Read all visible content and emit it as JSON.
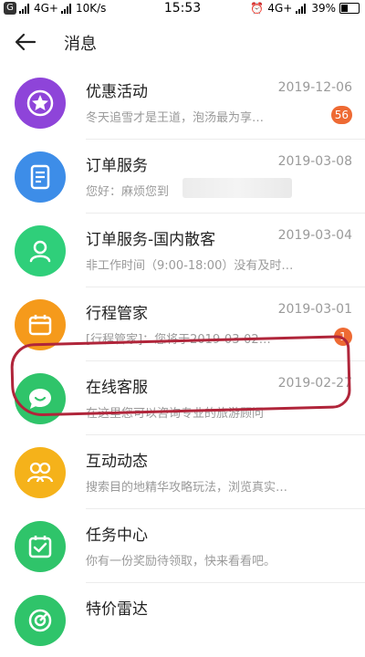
{
  "status_bar": {
    "carrier_icon": "G",
    "network_left": "4G+",
    "speed": "10K/s",
    "time": "15:53",
    "network_right": "4G+",
    "battery": "39%"
  },
  "header": {
    "title": "消息"
  },
  "messages": [
    {
      "name": "优惠活动",
      "date": "2019-12-06",
      "preview": "冬天追雪才是王道，泡汤最为享…",
      "badge": "56",
      "icon": "star-icon",
      "color": "#8e44d9"
    },
    {
      "name": "订单服务",
      "date": "2019-03-08",
      "preview": "您好：麻烦您到",
      "badge": "",
      "icon": "document-icon",
      "color": "#3d8de8"
    },
    {
      "name": "订单服务-国内散客",
      "date": "2019-03-04",
      "preview": "非工作时间（9:00-18:00）没有及时…",
      "badge": "",
      "icon": "person-icon",
      "color": "#2fcf7a"
    },
    {
      "name": "行程管家",
      "date": "2019-03-01",
      "preview": "[行程管家]：您将于2019-03-02…",
      "badge": "1",
      "icon": "calendar-icon",
      "color": "#f59a1b"
    },
    {
      "name": "在线客服",
      "date": "2019-02-27",
      "preview": "在这里您可以咨询专业的旅游顾问",
      "badge": "",
      "icon": "chat-bubble-icon",
      "color": "#2fc46a"
    },
    {
      "name": "互动动态",
      "date": "",
      "preview": "搜索目的地精华攻略玩法，浏览真实…",
      "badge": "",
      "icon": "people-icon",
      "color": "#f5b21a"
    },
    {
      "name": "任务中心",
      "date": "",
      "preview": "你有一份奖励待领取，快来看看吧。",
      "badge": "",
      "icon": "checklist-icon",
      "color": "#2fc46a"
    },
    {
      "name": "特价雷达",
      "date": "",
      "preview": "",
      "badge": "",
      "icon": "radar-icon",
      "color": "#2fc46a"
    }
  ]
}
